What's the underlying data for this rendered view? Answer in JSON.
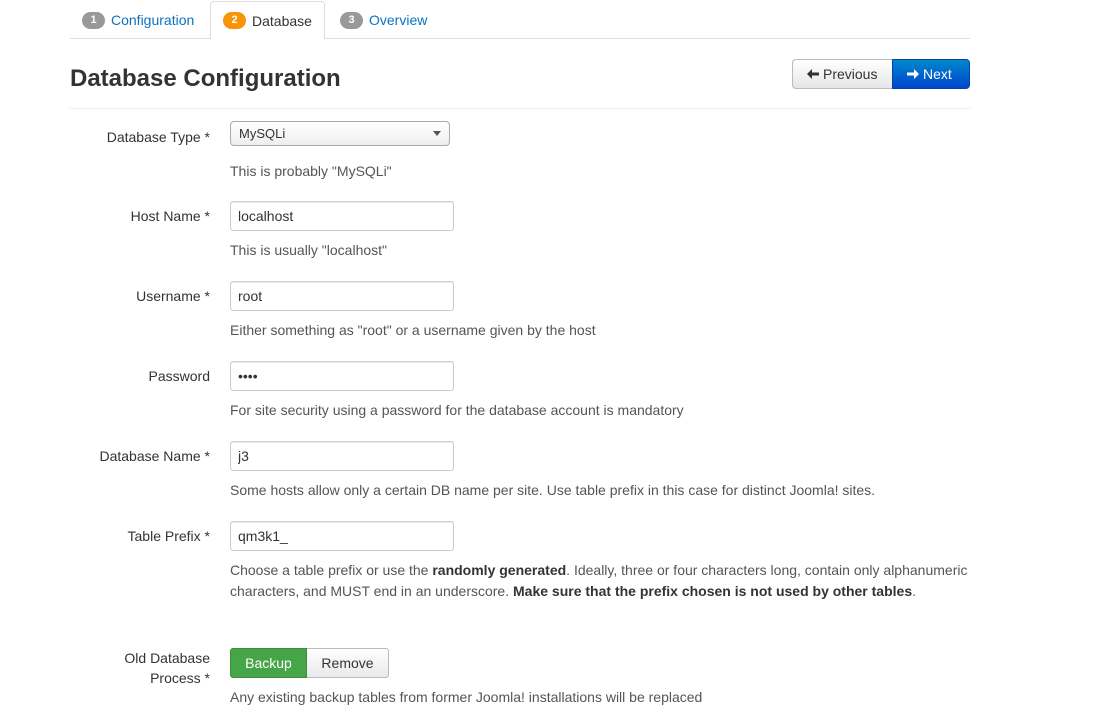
{
  "tabs": [
    {
      "num": "1",
      "label": "Configuration"
    },
    {
      "num": "2",
      "label": "Database"
    },
    {
      "num": "3",
      "label": "Overview"
    }
  ],
  "header": {
    "title": "Database Configuration",
    "prev_label": "Previous",
    "next_label": "Next"
  },
  "form": {
    "db_type": {
      "label": "Database Type *",
      "value": "MySQLi",
      "help": "This is probably \"MySQLi\""
    },
    "host": {
      "label": "Host Name *",
      "value": "localhost",
      "help": "This is usually \"localhost\""
    },
    "username": {
      "label": "Username *",
      "value": "root",
      "help": "Either something as \"root\" or a username given by the host"
    },
    "password": {
      "label": "Password",
      "value": "••••",
      "help": "For site security using a password for the database account is mandatory"
    },
    "db_name": {
      "label": "Database Name *",
      "value": "j3",
      "help": "Some hosts allow only a certain DB name per site. Use table prefix in this case for distinct Joomla! sites."
    },
    "prefix": {
      "label": "Table Prefix *",
      "value": "qm3k1_",
      "help_1": "Choose a table prefix or use the ",
      "help_2": "randomly generated",
      "help_3": ". Ideally, three or four characters long, contain only alphanumeric characters, and MUST end in an underscore. ",
      "help_4": "Make sure that the prefix chosen is not used by other tables",
      "help_5": "."
    },
    "old_db": {
      "label_1": "Old Database",
      "label_2": "Process *",
      "backup_label": "Backup",
      "remove_label": "Remove",
      "help": "Any existing backup tables from former Joomla! installations will be replaced"
    }
  },
  "colors": {
    "accent": "#0a73c0",
    "active_badge": "#f89406",
    "primary": "#0055cc",
    "success": "#46a546"
  }
}
